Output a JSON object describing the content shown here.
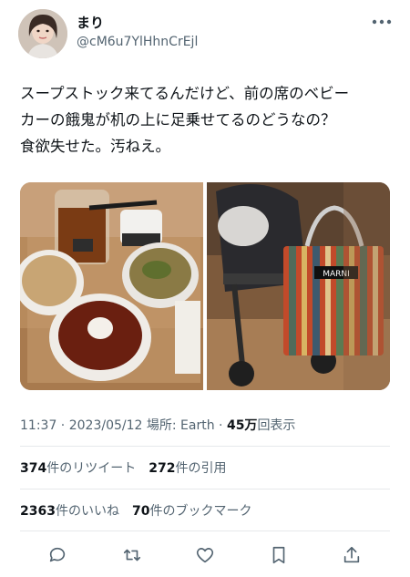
{
  "user": {
    "display_name": "まり",
    "handle": "@cM6u7YlHhnCrEjl",
    "more_icon": "more-icon"
  },
  "tweet": {
    "lines": [
      "スープストック来てるんだけど、前の席のベビー",
      "カーの餓鬼が机の上に足乗せてるのどうなの？",
      "食欲失せた。汚ねえ。"
    ]
  },
  "media": {
    "images": [
      {
        "name": "soup-stock-meal-photo"
      },
      {
        "name": "stroller-with-bag-photo"
      }
    ],
    "bag_brand_text": "MARNI"
  },
  "meta": {
    "time": "11:37",
    "sep1": " · ",
    "date": "2023/05/12",
    "location": " 場所: Earth",
    "sep2": " · ",
    "views_count": "45万",
    "views_label": "回表示"
  },
  "stats": {
    "retweets_count": "374",
    "retweets_label": "件のリツイート",
    "quotes_count": "272",
    "quotes_label": "件の引用",
    "likes_count": "2363",
    "likes_label": "件のいいね",
    "bookmarks_count": "70",
    "bookmarks_label": "件のブックマーク"
  },
  "actions": [
    "reply-icon",
    "retweet-icon",
    "like-icon",
    "bookmark-icon",
    "share-icon"
  ],
  "colors": {
    "text": "#0f1419",
    "secondary": "#536471",
    "divider": "#e6e9eb"
  }
}
